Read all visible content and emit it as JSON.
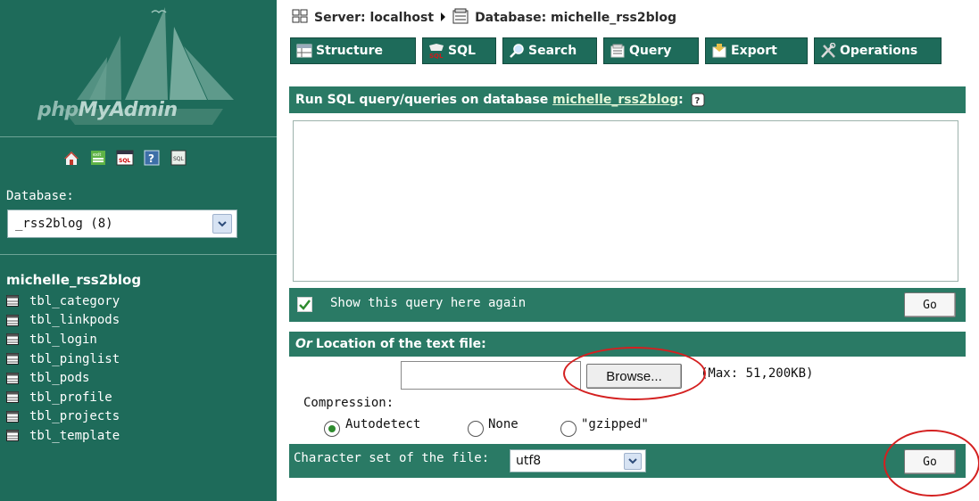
{
  "sidebar": {
    "logo": {
      "part1": "php",
      "part2": "MyAdmin"
    },
    "toolbar_icons": [
      "home-icon",
      "exit-icon",
      "sql-icon",
      "help-icon",
      "query-window-icon"
    ],
    "database_label": "Database:",
    "database_select_value": "_rss2blog (8)",
    "database_name": "michelle_rss2blog",
    "tables": [
      "tbl_category",
      "tbl_linkpods",
      "tbl_login",
      "tbl_pinglist",
      "tbl_pods",
      "tbl_profile",
      "tbl_projects",
      "tbl_template"
    ]
  },
  "breadcrumb": {
    "server": "Server: localhost",
    "database": "Database: michelle_rss2blog"
  },
  "tabs": [
    {
      "label": "Structure",
      "icon": "structure-icon"
    },
    {
      "label": "SQL",
      "icon": "sql-icon"
    },
    {
      "label": "Search",
      "icon": "search-icon"
    },
    {
      "label": "Query",
      "icon": "query-icon"
    },
    {
      "label": "Export",
      "icon": "export-icon"
    },
    {
      "label": "Operations",
      "icon": "operations-icon"
    }
  ],
  "query_panel": {
    "header_prefix": "Run SQL query/queries on database",
    "header_db_link": "michelle_rss2blog",
    "header_suffix": ":",
    "query_text": "",
    "show_again_label": "Show this query here again",
    "show_again_checked": true,
    "go_label": "Go"
  },
  "upload": {
    "header_or": "Or",
    "header_text": "Location of the text file:",
    "browse_label": "Browse...",
    "max_label": "(Max: 51,200KB)",
    "compression_label": "Compression:",
    "compression_options": [
      "Autodetect",
      "None",
      "\"gzipped\""
    ],
    "compression_selected": "Autodetect",
    "charset_label": "Character set of the file:",
    "charset_value": "utf8",
    "go_label": "Go"
  },
  "colors": {
    "sidebar_bg": "#1e6b5a",
    "bar_bg": "#2a7a65",
    "annotation": "#d42020"
  }
}
